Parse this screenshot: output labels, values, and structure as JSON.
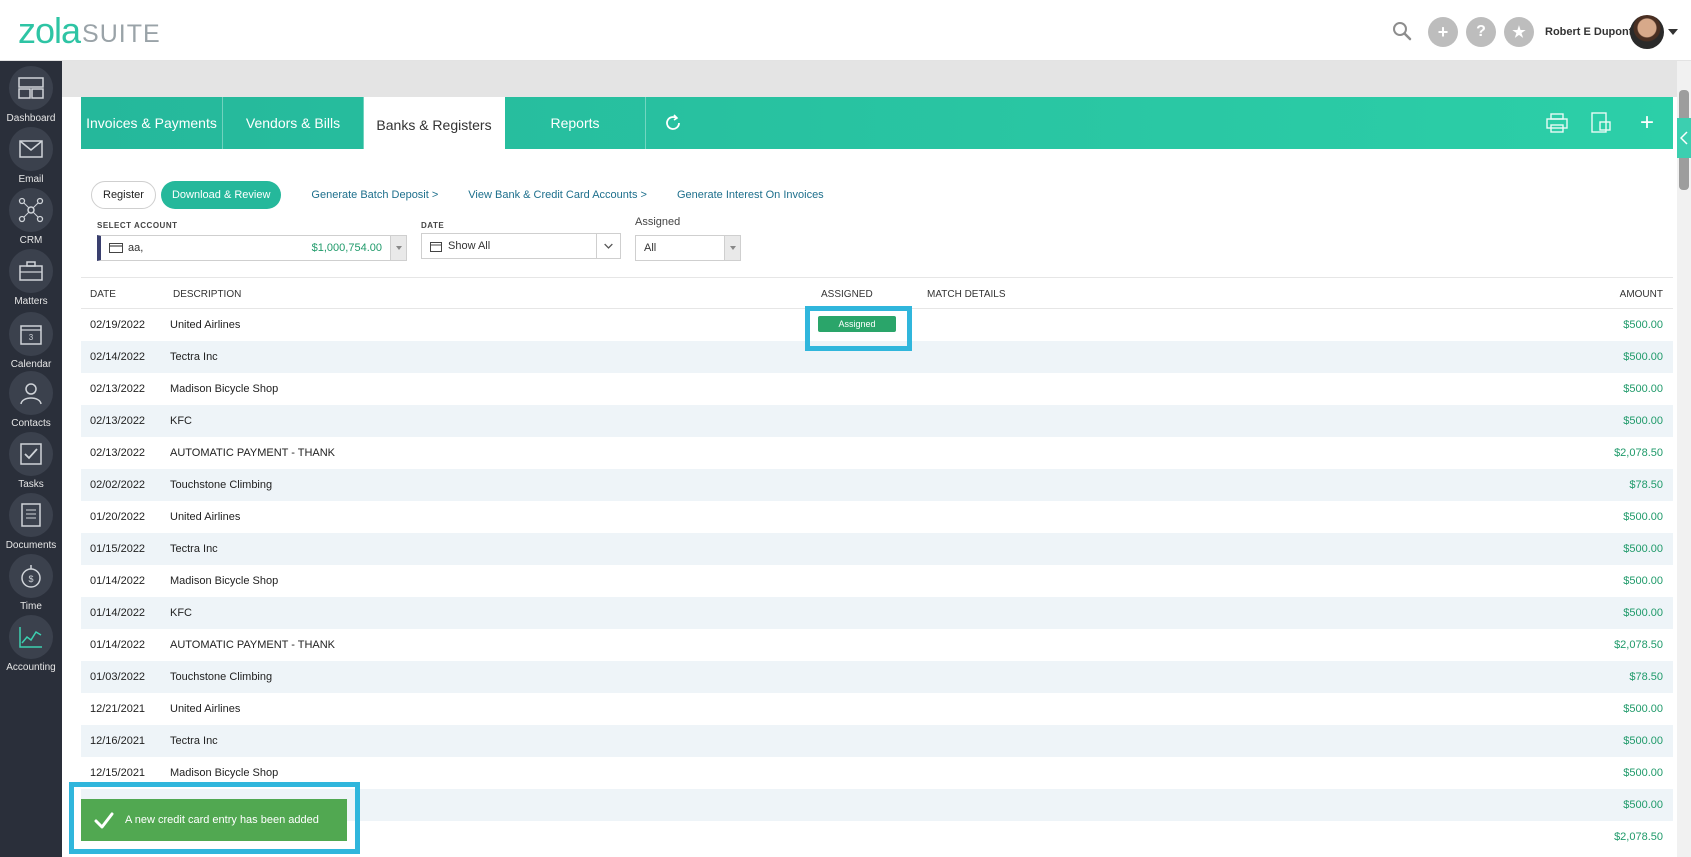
{
  "brand": {
    "logo_main": "zola",
    "logo_sub": "SUITE",
    "accent": "#2ccfa8"
  },
  "header": {
    "user_name": "Robert E Dupont"
  },
  "sidebar": {
    "items": [
      {
        "label": "Dashboard",
        "icon": "dashboard-icon"
      },
      {
        "label": "Email",
        "icon": "email-icon"
      },
      {
        "label": "CRM",
        "icon": "crm-icon"
      },
      {
        "label": "Matters",
        "icon": "briefcase-icon"
      },
      {
        "label": "Calendar",
        "icon": "calendar-icon"
      },
      {
        "label": "Contacts",
        "icon": "contacts-icon"
      },
      {
        "label": "Tasks",
        "icon": "tasks-icon"
      },
      {
        "label": "Documents",
        "icon": "documents-icon"
      },
      {
        "label": "Time",
        "icon": "stopwatch-icon"
      },
      {
        "label": "Accounting",
        "icon": "chart-icon"
      }
    ]
  },
  "tabs": [
    {
      "label": "Invoices & Payments"
    },
    {
      "label": "Vendors & Bills"
    },
    {
      "label": "Banks & Registers"
    },
    {
      "label": "Reports"
    }
  ],
  "subnav": {
    "register": "Register",
    "download_review": "Download & Review",
    "links": [
      "Generate Batch Deposit >",
      "View Bank & Credit Card Accounts >",
      "Generate Interest On Invoices"
    ]
  },
  "filters": {
    "account_label": "SELECT ACCOUNT",
    "account_name": "aa,",
    "account_balance": "$1,000,754.00",
    "date_label": "DATE",
    "date_value": "Show All",
    "assigned_label": "Assigned",
    "assigned_value": "All"
  },
  "table": {
    "headers": {
      "date": "DATE",
      "description": "DESCRIPTION",
      "assigned": "ASSIGNED",
      "match": "MATCH DETAILS",
      "amount": "AMOUNT"
    },
    "assigned_badge": "Assigned",
    "rows": [
      {
        "date": "02/19/2022",
        "desc": "United Airlines",
        "amount": "$500.00"
      },
      {
        "date": "02/14/2022",
        "desc": "Tectra Inc",
        "amount": "$500.00"
      },
      {
        "date": "02/13/2022",
        "desc": "Madison Bicycle Shop",
        "amount": "$500.00"
      },
      {
        "date": "02/13/2022",
        "desc": "KFC",
        "amount": "$500.00"
      },
      {
        "date": "02/13/2022",
        "desc": "AUTOMATIC PAYMENT - THANK",
        "amount": "$2,078.50"
      },
      {
        "date": "02/02/2022",
        "desc": "Touchstone Climbing",
        "amount": "$78.50"
      },
      {
        "date": "01/20/2022",
        "desc": "United Airlines",
        "amount": "$500.00"
      },
      {
        "date": "01/15/2022",
        "desc": "Tectra Inc",
        "amount": "$500.00"
      },
      {
        "date": "01/14/2022",
        "desc": "Madison Bicycle Shop",
        "amount": "$500.00"
      },
      {
        "date": "01/14/2022",
        "desc": "KFC",
        "amount": "$500.00"
      },
      {
        "date": "01/14/2022",
        "desc": "AUTOMATIC PAYMENT - THANK",
        "amount": "$2,078.50"
      },
      {
        "date": "01/03/2022",
        "desc": "Touchstone Climbing",
        "amount": "$78.50"
      },
      {
        "date": "12/21/2021",
        "desc": "United Airlines",
        "amount": "$500.00"
      },
      {
        "date": "12/16/2021",
        "desc": "Tectra Inc",
        "amount": "$500.00"
      },
      {
        "date": "12/15/2021",
        "desc": "Madison Bicycle Shop",
        "amount": "$500.00"
      },
      {
        "date": "",
        "desc": "",
        "amount": "$500.00"
      },
      {
        "date": "",
        "desc": "",
        "amount": "$2,078.50"
      }
    ]
  },
  "toast": {
    "message": "A new credit card entry has been added"
  }
}
